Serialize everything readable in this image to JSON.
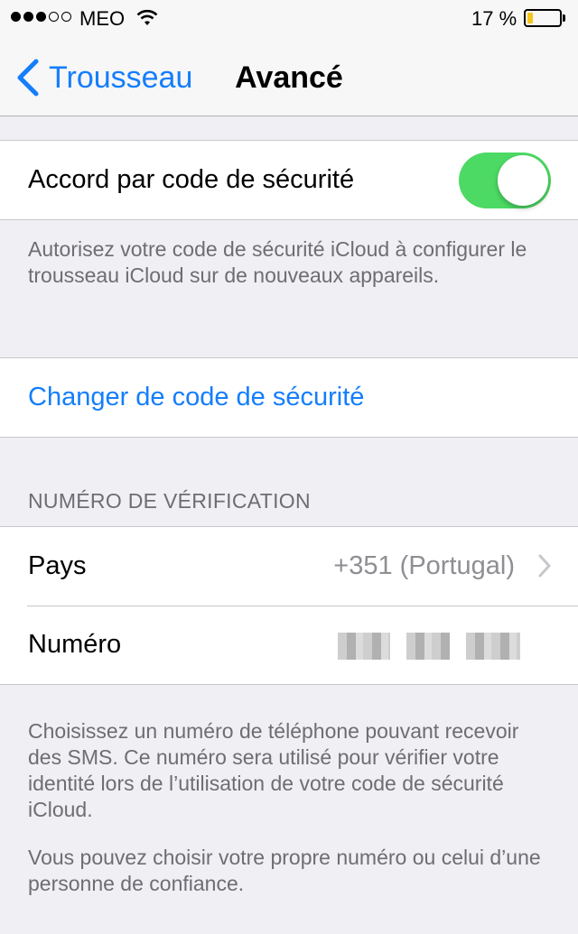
{
  "status_bar": {
    "carrier": "MEO",
    "battery_percent": "17 %",
    "battery_level": 0.17,
    "signal_bars_filled": 3,
    "signal_bars_total": 5
  },
  "nav": {
    "back_label": "Trousseau",
    "title": "Avancé"
  },
  "security_code": {
    "approve_label": "Accord par code de sécurité",
    "approve_enabled": true,
    "approve_footer": "Autorisez votre code de sécurité iCloud à configurer le trousseau iCloud sur de nouveaux appareils.",
    "change_label": "Changer de code de sécurité"
  },
  "verification": {
    "header": "NUMÉRO DE VÉRIFICATION",
    "country_label": "Pays",
    "country_value": "+351 (Portugal)",
    "number_label": "Numéro",
    "footer_1": "Choisissez un numéro de téléphone pouvant recevoir des SMS. Ce numéro sera utilisé pour vérifier votre identité lors de l’utilisation de votre code de sécurité iCloud.",
    "footer_2": "Vous pouvez choisir votre propre numéro ou celui d’une personne de confiance."
  },
  "colors": {
    "accent": "#147efb",
    "toggle_on": "#4cd964",
    "battery": "#f5c518"
  }
}
